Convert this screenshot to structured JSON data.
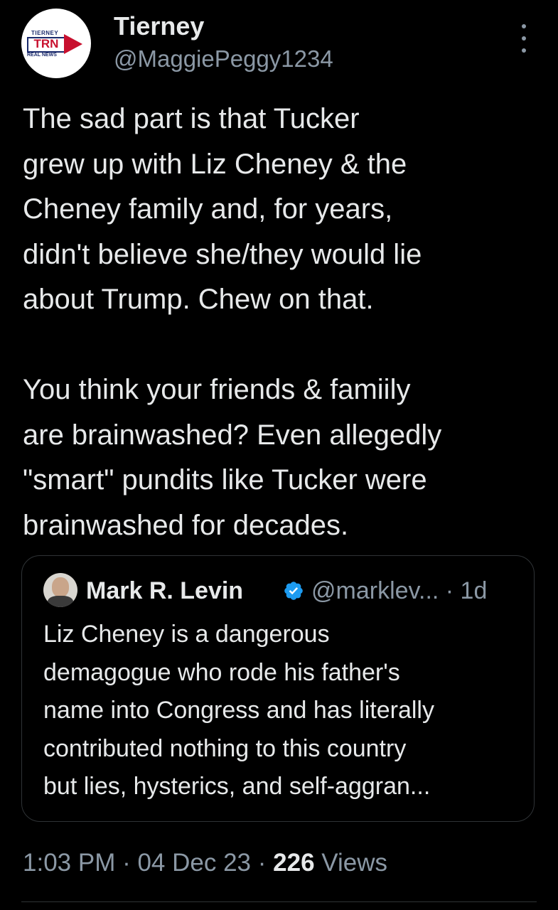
{
  "author": {
    "display_name": "Tierney",
    "handle": "@MaggiePeggy1234",
    "avatar_logo": {
      "top_text": "TIERNEY",
      "main_text": "TRN",
      "bottom_text": "REAL NEWS"
    }
  },
  "icons": {
    "more": "more-vertical-icon",
    "verified": "verified-badge-icon"
  },
  "tweet": {
    "text": "The sad part is that Tucker\ngrew up with Liz Cheney & the\nCheney family and, for years,\ndidn't believe she/they would lie\nabout Trump. Chew on that.\n\nYou think your friends & famiily\nare brainwashed? Even allegedly\n\"smart\" pundits like Tucker were\nbrainwashed for decades."
  },
  "quote": {
    "name": "Mark R. Levin",
    "handle": "@marklev... · 1d",
    "text": "Liz Cheney is a dangerous\ndemagogue who rode his father's\nname into Congress and has literally\ncontributed nothing to this country\nbut lies, hysterics, and self-aggran..."
  },
  "meta": {
    "time": "1:03 PM",
    "separator": " · ",
    "date": "04 Dec 23",
    "views_count": "226",
    "views_label": " Views"
  },
  "colors": {
    "background": "#000000",
    "text_primary": "#e7e9ea",
    "text_secondary": "#8b98a5",
    "border": "#2f3336",
    "verified_blue": "#1d9bf0",
    "logo_red": "#c8102e",
    "logo_navy": "#1a2a6c"
  }
}
